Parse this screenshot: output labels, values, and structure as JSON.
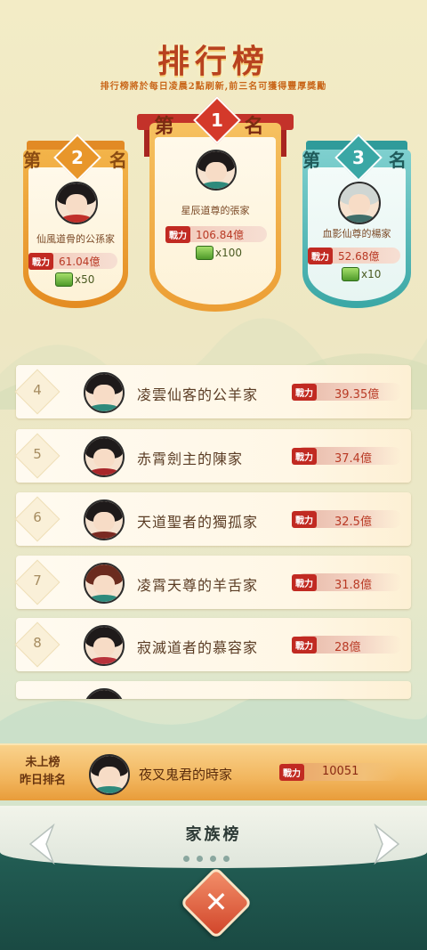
{
  "header": {
    "title": "排行榜",
    "subtitle": "排行榜將於每日凌晨2點刷新,前三名可獲得豐厚獎勵"
  },
  "podium": [
    {
      "rank_text": "第名",
      "rank": "2",
      "name": "仙風道骨的公孫家",
      "power_label": "戰力",
      "power": "61.04億",
      "reward": "x50"
    },
    {
      "rank_text": "第名",
      "rank": "1",
      "name": "星辰道尊的張家",
      "power_label": "戰力",
      "power": "106.84億",
      "reward": "x100"
    },
    {
      "rank_text": "第名",
      "rank": "3",
      "name": "血影仙尊的楊家",
      "power_label": "戰力",
      "power": "52.68億",
      "reward": "x10"
    }
  ],
  "rows": [
    {
      "rank": "4",
      "name": "凌雲仙客的公羊家",
      "power_label": "戰力",
      "power": "39.35億"
    },
    {
      "rank": "5",
      "name": "赤霄劍主的陳家",
      "power_label": "戰力",
      "power": "37.4億"
    },
    {
      "rank": "6",
      "name": "天道聖者的獨孤家",
      "power_label": "戰力",
      "power": "32.5億"
    },
    {
      "rank": "7",
      "name": "凌霄天尊的羊舌家",
      "power_label": "戰力",
      "power": "31.8億"
    },
    {
      "rank": "8",
      "name": "寂滅道者的慕容家",
      "power_label": "戰力",
      "power": "28億"
    }
  ],
  "my_rank": {
    "line1": "未上榜",
    "line2": "昨日排名",
    "name": "夜叉鬼君的時家",
    "power_label": "戰力",
    "power": "10051"
  },
  "footer": {
    "tab_title": "家族榜",
    "page_dots": 4,
    "close_icon": "close-icon"
  },
  "colors": {
    "gold": "#f0a33a",
    "red": "#c93a22",
    "teal": "#3aa7a5",
    "power_red": "#c12a22"
  }
}
